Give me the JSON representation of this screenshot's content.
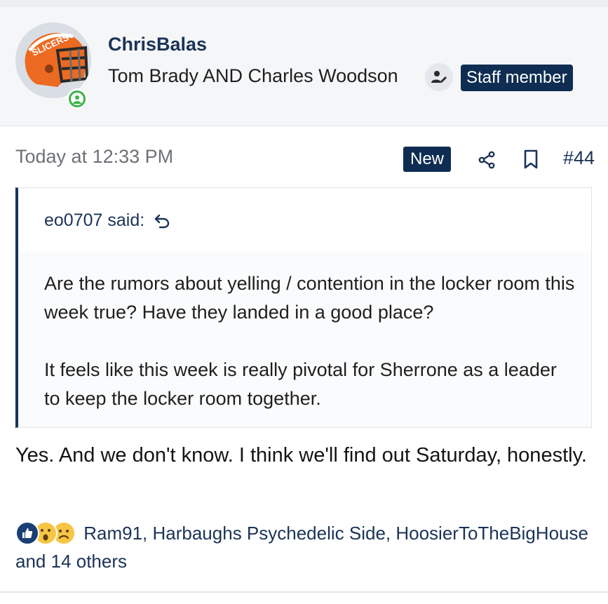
{
  "user": {
    "username": "ChrisBalas",
    "title": "Tom Brady AND Charles Woodson",
    "badge": "Staff member",
    "avatar_text": "SLICERS",
    "status_color": "#3bb34a"
  },
  "post": {
    "timestamp": "Today at 12:33 PM",
    "new_label": "New",
    "number": "#44",
    "accent_color": "#0f2d52"
  },
  "quote": {
    "author": "eo0707 said:",
    "paragraphs": [
      "Are the rumors about yelling / contention in the locker room this week true? Have they landed in a good place?",
      "It feels like this week is really pivotal for Sherrone as a leader to keep the locker room together."
    ]
  },
  "body": {
    "text": "Yes. And we don't know. I think we'll find out Saturday, honestly."
  },
  "reactions": {
    "icons": [
      "like-icon",
      "wow-icon",
      "sad-icon"
    ],
    "summary": "Ram91, Harbaughs Psychedelic Side, HoosierToTheBigHouse and 14 others"
  }
}
